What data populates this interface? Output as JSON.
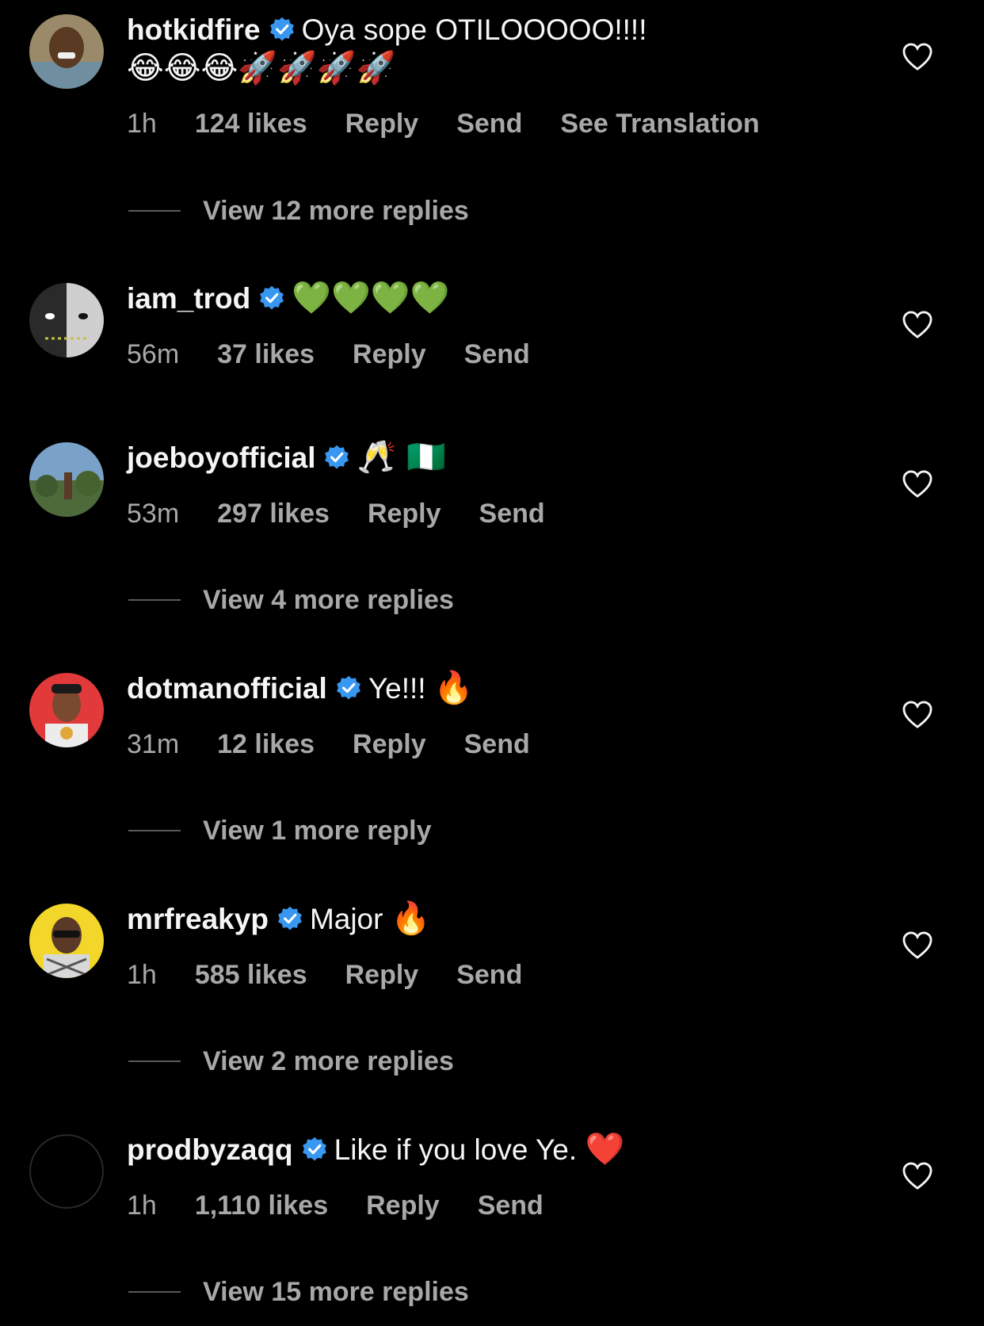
{
  "colors": {
    "background": "#000000",
    "primary_text": "#f5f5f5",
    "secondary_text": "#a8a8a8",
    "verified_badge": "#3897f0",
    "reply_rule": "#5a5a5a"
  },
  "comments": [
    {
      "username": "hotkidfire",
      "verified": true,
      "text": "Oya sope OTILOOOOO!!!!",
      "emoji": "😂😂😂🚀🚀🚀🚀",
      "time": "1h",
      "likes": "124 likes",
      "reply": "Reply",
      "send": "Send",
      "extra": "See Translation",
      "view_replies": "View 12 more replies",
      "like_icon": "heart-outline-icon"
    },
    {
      "username": "iam_trod",
      "verified": true,
      "text": "",
      "emoji": "💚💚💚💚",
      "time": "56m",
      "likes": "37 likes",
      "reply": "Reply",
      "send": "Send",
      "like_icon": "heart-outline-icon"
    },
    {
      "username": "joeboyofficial",
      "verified": true,
      "text": "",
      "emoji": "🥂 🇳🇬",
      "time": "53m",
      "likes": "297 likes",
      "reply": "Reply",
      "send": "Send",
      "view_replies": "View 4 more replies",
      "like_icon": "heart-outline-icon"
    },
    {
      "username": "dotmanofficial",
      "verified": true,
      "text": "Ye!!!",
      "emoji": "🔥",
      "time": "31m",
      "likes": "12 likes",
      "reply": "Reply",
      "send": "Send",
      "view_replies": "View 1 more reply",
      "like_icon": "heart-outline-icon"
    },
    {
      "username": "mrfreakyp",
      "verified": true,
      "text": "Major",
      "emoji": "🔥",
      "time": "1h",
      "likes": "585 likes",
      "reply": "Reply",
      "send": "Send",
      "view_replies": "View 2 more replies",
      "like_icon": "heart-outline-icon"
    },
    {
      "username": "prodbyzaqq",
      "verified": true,
      "text": "Like if you love Ye.",
      "emoji": "❤️",
      "time": "1h",
      "likes": "1,110 likes",
      "reply": "Reply",
      "send": "Send",
      "view_replies": "View 15 more replies",
      "like_icon": "heart-outline-icon"
    }
  ]
}
